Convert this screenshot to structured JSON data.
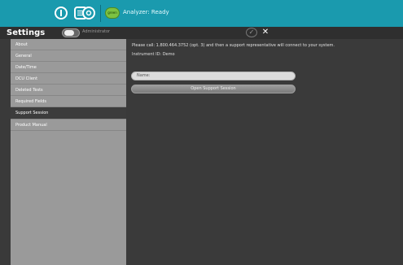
{
  "toolbar": {
    "status_chip": "green",
    "status_text": "Analyzer: Ready",
    "icons": [
      "test-tube-icon",
      "list-icon",
      "gear-icon"
    ]
  },
  "header": {
    "title": "Settings",
    "toggle_label": "Administrator",
    "confirm_icon": "check-icon",
    "close_icon": "close-icon"
  },
  "sidebar": {
    "items": [
      {
        "label": "About"
      },
      {
        "label": "General"
      },
      {
        "label": "Date/Time"
      },
      {
        "label": "DCU Client"
      },
      {
        "label": "Deleted Tests"
      },
      {
        "label": "Required Fields"
      },
      {
        "label": "Support Session",
        "selected": true
      },
      {
        "label": "Product Manual"
      }
    ]
  },
  "main": {
    "instructions": "Please call: 1.800.464.3752 (opt. 3) and then a support representative will connect to your system.",
    "instrument_id": "Instrument ID: Demo",
    "name_field_placeholder": "Name:",
    "open_button": "Open Support Session"
  },
  "colors": {
    "toolbar_bg": "#1a9aae",
    "sidebar_bg": "#9a9a9a",
    "sidebar_selected": "#3c3c3c",
    "content_bg": "#3a3a3a",
    "status_green": "#7cc242"
  }
}
